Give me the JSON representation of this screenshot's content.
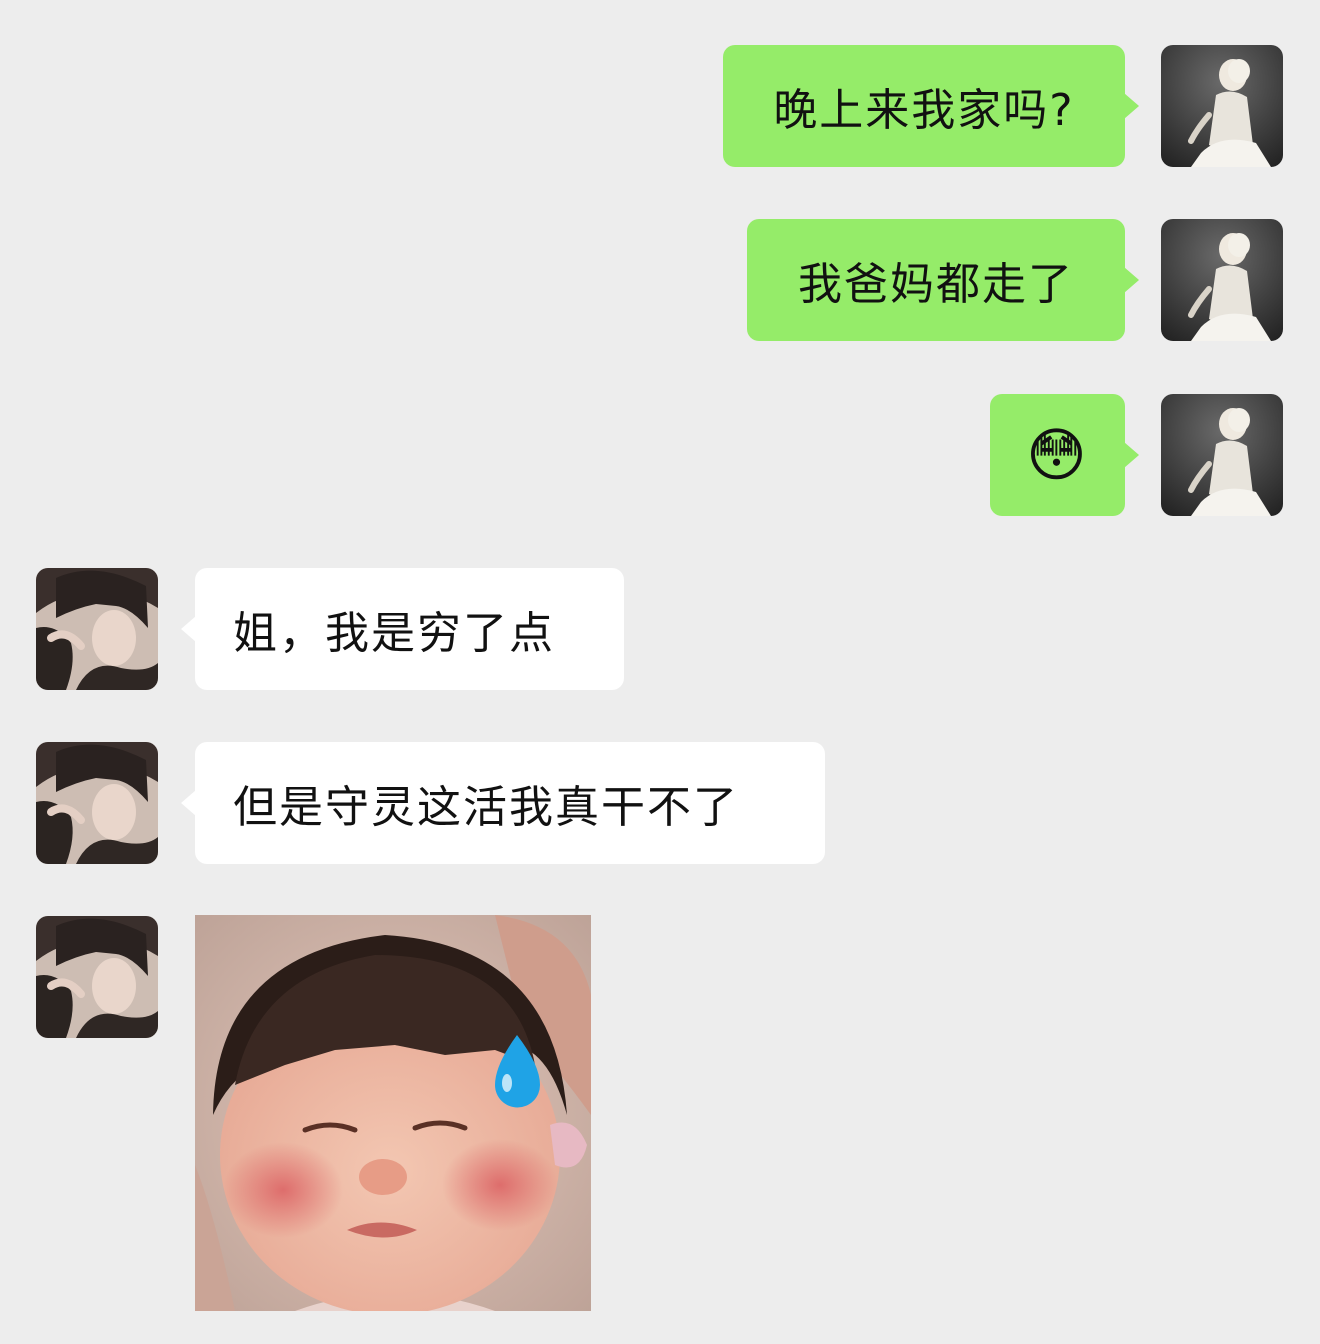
{
  "chat": {
    "messages": [
      {
        "side": "me",
        "text": "晚上来我家吗?"
      },
      {
        "side": "me",
        "text": "我爸妈都走了"
      },
      {
        "side": "me",
        "text": "😳",
        "emoji_name": "blushing-smile-emoji"
      },
      {
        "side": "other",
        "text": "姐，我是穷了点"
      },
      {
        "side": "other",
        "text": "但是守灵这活我真干不了"
      },
      {
        "side": "other",
        "type": "sticker",
        "sticker_name": "crying-child-sweat-drop-sticker"
      }
    ]
  },
  "colors": {
    "background": "#ededed",
    "my_bubble": "#95ec69",
    "other_bubble": "#ffffff",
    "sweat_drop": "#1fa3e6"
  }
}
